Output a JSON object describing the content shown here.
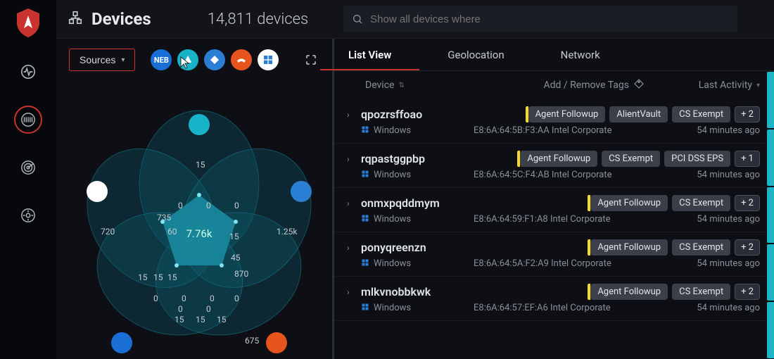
{
  "header": {
    "title": "Devices",
    "count": "14,811 devices",
    "search_placeholder": "Show all devices where"
  },
  "viz": {
    "sources_label": "Sources",
    "source_icons": [
      {
        "name": "neb-icon",
        "bg": "#1a6fd6",
        "label": "NEB"
      },
      {
        "name": "alien-icon",
        "bg": "#18b3c9",
        "label": ""
      },
      {
        "name": "azure-icon",
        "bg": "#2a7fd4",
        "label": ""
      },
      {
        "name": "crowd-icon",
        "bg": "#e8541e",
        "label": ""
      },
      {
        "name": "win-icon",
        "bg": "#ffffff",
        "label": ""
      }
    ],
    "center_value": "7.76k",
    "labels": [
      "15",
      "720",
      "735",
      "60",
      "0",
      "0",
      "0",
      "15",
      "1.25k",
      "45",
      "870",
      "15",
      "15",
      "15",
      "0",
      "0",
      "0",
      "0",
      "0",
      "0",
      "15",
      "15",
      "15",
      "675"
    ]
  },
  "tabs": [
    "List View",
    "Geolocation",
    "Network"
  ],
  "active_tab": 0,
  "columns": {
    "device": "Device",
    "tags": "Add / Remove Tags",
    "activity": "Last Activity"
  },
  "rows": [
    {
      "name": "qpozrsffoao",
      "os": "Windows",
      "mac": "E8:6A:64:5B:F3:AA Intel Corporate",
      "tags": [
        "Agent Followup",
        "AlientVault",
        "CS Exempt"
      ],
      "more": "+ 2",
      "activity": "54 minutes ago"
    },
    {
      "name": "rqpastggpbp",
      "os": "Windows",
      "mac": "E8:6A:64:5C:F4:AB Intel Corporate",
      "tags": [
        "Agent Followup",
        "CS Exempt",
        "PCI DSS EPS"
      ],
      "more": "+ 1",
      "activity": "54 minutes ago"
    },
    {
      "name": "onmxpqddmym",
      "os": "Windows",
      "mac": "E8:6A:64:59:F1:A8  Intel Corporate",
      "tags": [
        "Agent Followup",
        "CS Exempt"
      ],
      "more": "+ 2",
      "activity": "54 minutes ago"
    },
    {
      "name": "ponyqreenzn",
      "os": "Windows",
      "mac": "E8:6A:64:5A:F2:A9 Intel Corporate",
      "tags": [
        "Agent Followup",
        "CS Exempt"
      ],
      "more": "+ 2",
      "activity": "54 minutes ago"
    },
    {
      "name": "mlkvnobbkwk",
      "os": "Windows",
      "mac": "E8:6A:64:57:EF:A6 Intel Corporate",
      "tags": [
        "Agent Followup",
        "CS Exempt"
      ],
      "more": "+ 2",
      "activity": "54 minutes ago"
    }
  ],
  "mark_colors": [
    "#1fb5c9",
    "#1fb5c9",
    "#1fb5c9",
    "#1fb5c9",
    "#1fb5c9"
  ]
}
